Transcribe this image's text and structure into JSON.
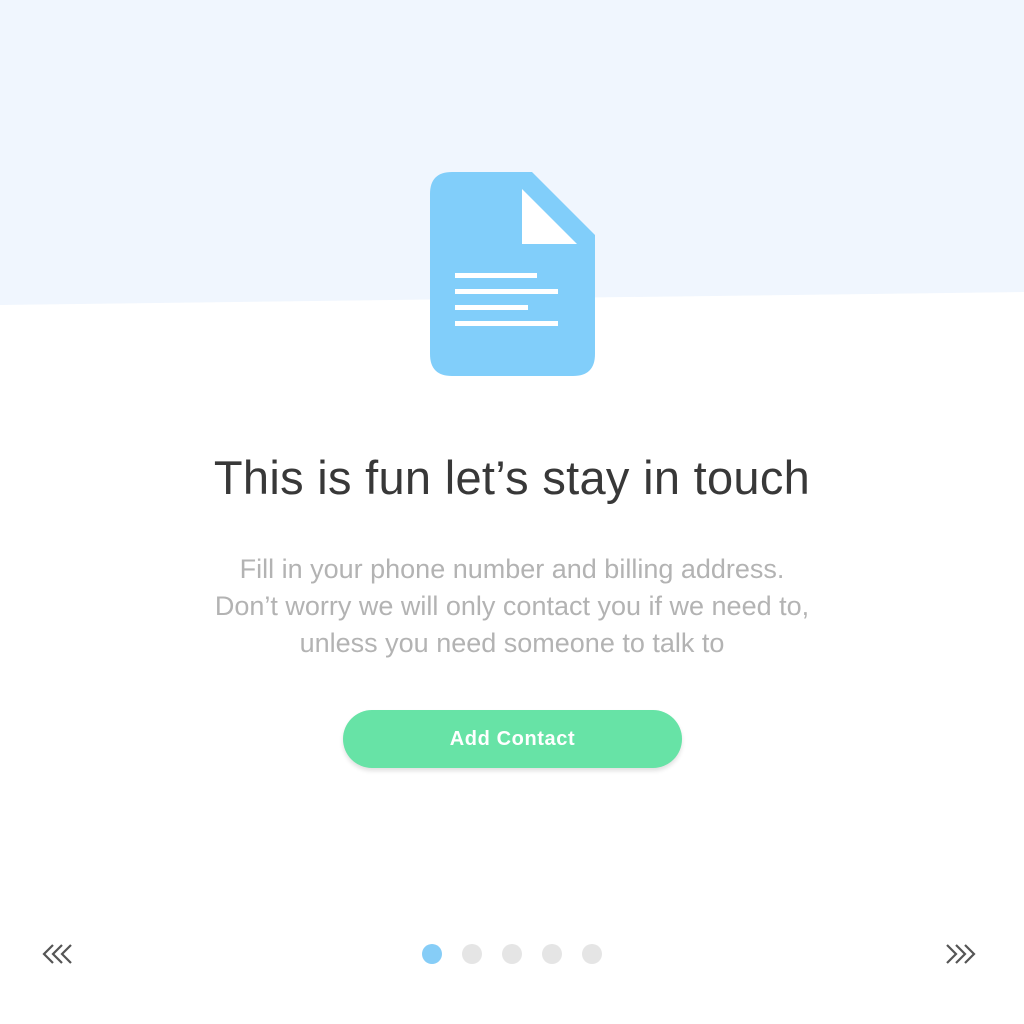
{
  "colors": {
    "top_band": "#f0f6fe",
    "document_icon": "#81cefa",
    "title_text": "#383838",
    "body_text": "#b3b3b3",
    "primary_button": "#67e3a6",
    "dot_active": "#86cdf7",
    "dot_inactive": "#e5e5e5"
  },
  "hero": {
    "icon": "document-icon"
  },
  "content": {
    "title": "This is fun let’s stay in touch",
    "body_lines": [
      "Fill in your phone number and billing address.",
      "Don’t worry we will only contact you if we need to,",
      "unless you need someone to talk to"
    ]
  },
  "actions": {
    "primary_label": "Add Contact"
  },
  "pagination": {
    "total_pages": 5,
    "current_page": 1,
    "prev_icon": "triple-chevron-left-icon",
    "next_icon": "triple-chevron-right-icon"
  }
}
